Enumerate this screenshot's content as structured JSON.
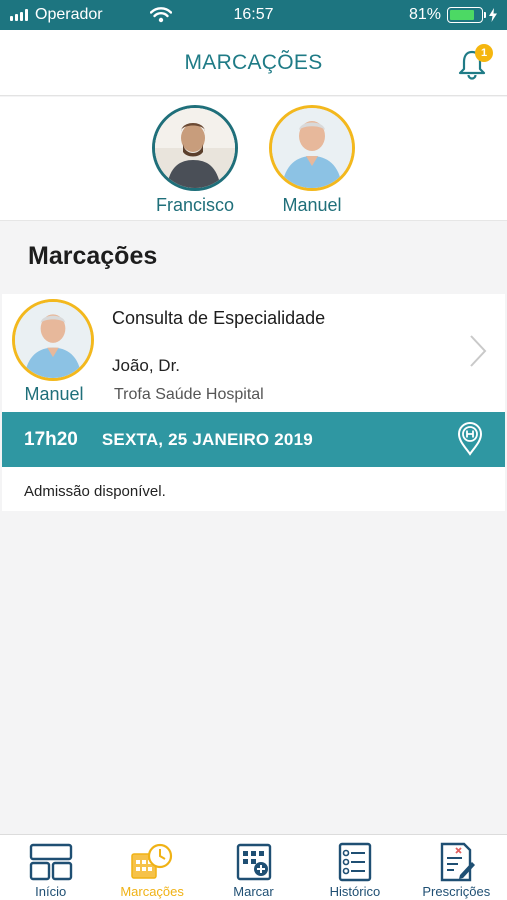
{
  "status_bar": {
    "carrier": "Operador",
    "time": "16:57",
    "battery": "81%",
    "battery_level": 0.81
  },
  "header": {
    "title": "MARCAÇÕES",
    "notification_count": "1"
  },
  "profiles": [
    {
      "name": "Francisco",
      "selected": false
    },
    {
      "name": "Manuel",
      "selected": true
    }
  ],
  "section": {
    "title": "Marcações"
  },
  "appointment": {
    "person": "Manuel",
    "type": "Consulta de Especialidade",
    "doctor": "João, Dr.",
    "location": "Trofa Saúde Hospital",
    "time": "17h20",
    "date": "SEXTA, 25 JANEIRO 2019",
    "status": "Admissão disponível."
  },
  "tabbar": {
    "items": [
      {
        "label": "Início",
        "icon": "home-grid-icon",
        "active": false
      },
      {
        "label": "Marcações",
        "icon": "calendar-clock-icon",
        "active": true
      },
      {
        "label": "Marcar",
        "icon": "schedule-add-icon",
        "active": false
      },
      {
        "label": "Histórico",
        "icon": "history-list-icon",
        "active": false
      },
      {
        "label": "Prescrições",
        "icon": "prescription-icon",
        "active": false
      }
    ]
  },
  "colors": {
    "brand": "#1f7b86",
    "accent": "#f3b81d",
    "time_bar": "#2f97a2"
  }
}
